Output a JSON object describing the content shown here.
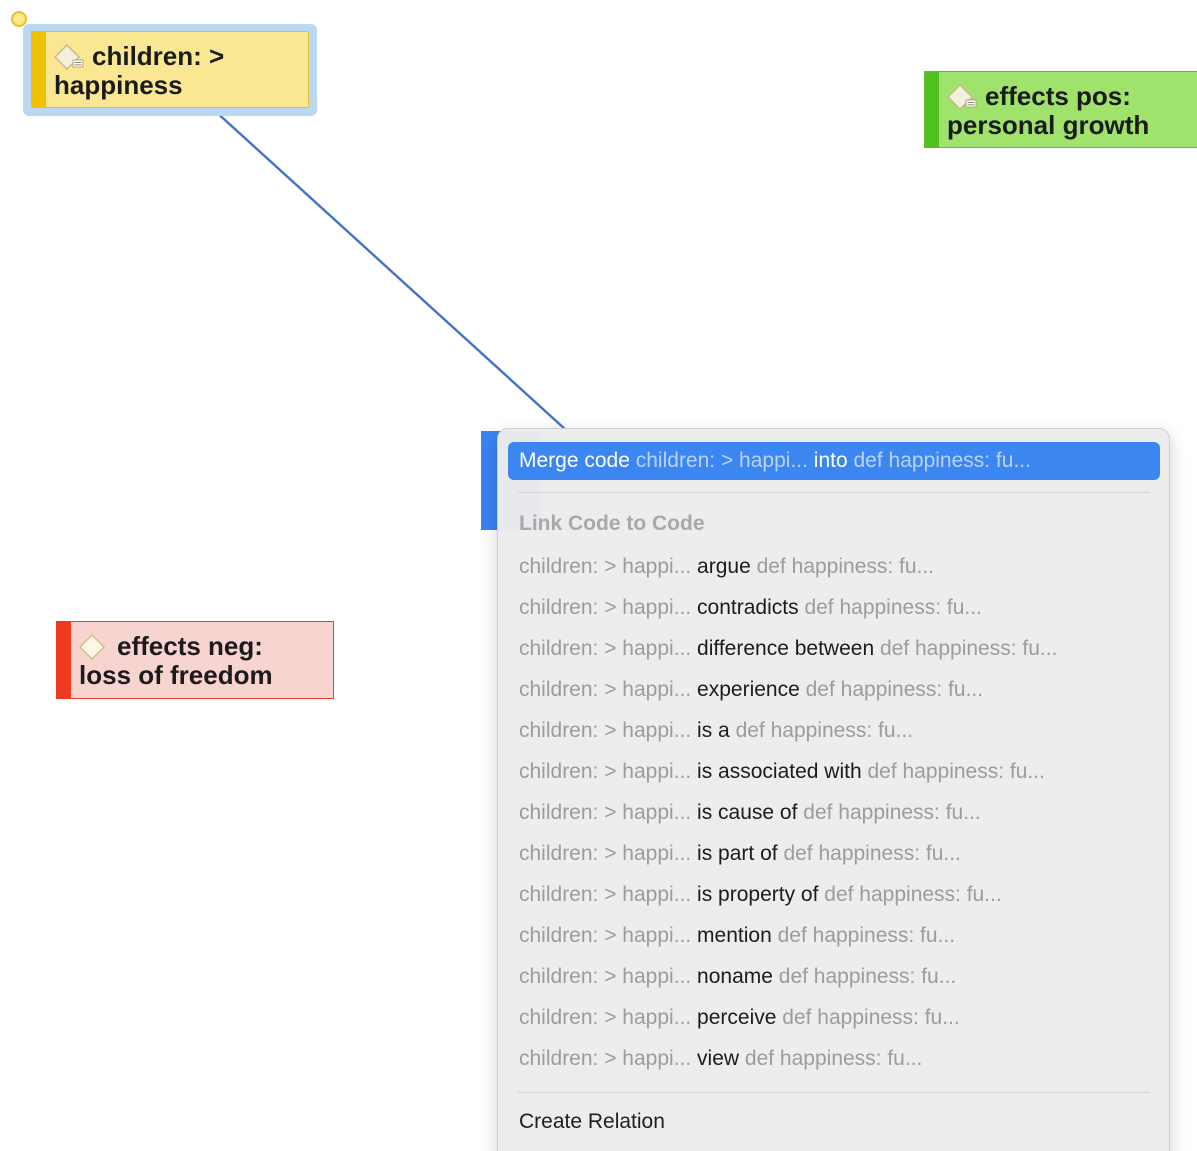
{
  "nodes": {
    "children": {
      "line1": "children: >",
      "line2": "happiness",
      "color": "#f9e891",
      "stripe_color": "#f2c200"
    },
    "effects_pos": {
      "line1": "effects pos:",
      "line2": "personal growth",
      "color": "#9fe26c",
      "stripe_color": "#4fc21d"
    },
    "effects_neg": {
      "line1": "effects neg:",
      "line2": "loss of freedom",
      "color": "#f8d4d1",
      "stripe_color": "#f03a1f"
    }
  },
  "menu": {
    "merge": {
      "merge_label": "Merge code",
      "source": "children: > happi...",
      "into_label": "into",
      "target": "def happiness: fu..."
    },
    "link_heading": "Link Code to Code",
    "link_items": [
      {
        "source": "children: > happi...",
        "relation": "argue",
        "target": "def happiness: fu..."
      },
      {
        "source": "children: > happi...",
        "relation": "contradicts",
        "target": "def happiness: fu..."
      },
      {
        "source": "children: > happi...",
        "relation": "difference between",
        "target": "def happiness: fu..."
      },
      {
        "source": "children: > happi...",
        "relation": "experience",
        "target": "def happiness: fu..."
      },
      {
        "source": "children: > happi...",
        "relation": "is a",
        "target": "def happiness: fu..."
      },
      {
        "source": "children: > happi...",
        "relation": "is associated with",
        "target": "def happiness: fu..."
      },
      {
        "source": "children: > happi...",
        "relation": "is cause of",
        "target": "def happiness: fu..."
      },
      {
        "source": "children: > happi...",
        "relation": "is part of",
        "target": "def happiness: fu..."
      },
      {
        "source": "children: > happi...",
        "relation": "is property of",
        "target": "def happiness: fu..."
      },
      {
        "source": "children: > happi...",
        "relation": "mention",
        "target": "def happiness: fu..."
      },
      {
        "source": "children: > happi...",
        "relation": "noname",
        "target": "def happiness: fu..."
      },
      {
        "source": "children: > happi...",
        "relation": "perceive",
        "target": "def happiness: fu..."
      },
      {
        "source": "children: > happi...",
        "relation": "view",
        "target": "def happiness: fu..."
      }
    ],
    "create_relation": "Create Relation"
  },
  "colors": {
    "accent": "#3b86f0",
    "link_line": "#3f74c9"
  }
}
